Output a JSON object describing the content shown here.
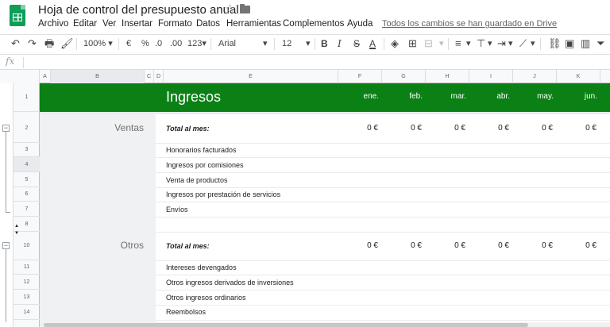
{
  "doc": {
    "title": "Hoja de control del presupuesto anual"
  },
  "menu": [
    "Archivo",
    "Editar",
    "Ver",
    "Insertar",
    "Formato",
    "Datos",
    "Herramientas",
    "Complementos",
    "Ayuda"
  ],
  "saved_status": "Todos los cambios se han guardado en Drive",
  "toolbar": {
    "zoom": "100%",
    "currency": "€",
    "percent": "%",
    "decrease_decimals": ".0",
    "increase_decimals": ".00",
    "format_more": "123",
    "font": "Arial",
    "font_size": "12",
    "bold": "B",
    "italic": "I",
    "strike": "S",
    "text_color": "A"
  },
  "formula_bar": {
    "fx": "fx"
  },
  "columns": [
    "A",
    "B",
    "C",
    "D",
    "E",
    "F",
    "G",
    "H",
    "I",
    "J",
    "K"
  ],
  "rows": [
    "1",
    "2",
    "3",
    "4",
    "5",
    "6",
    "7",
    "8",
    "10",
    "11",
    "12",
    "13",
    "14"
  ],
  "sheet": {
    "header_title": "Ingresos",
    "months": [
      "ene.",
      "feb.",
      "mar.",
      "abr.",
      "may.",
      "jun."
    ],
    "sections": [
      {
        "category": "Ventas",
        "total_label": "Total al mes:",
        "totals": [
          "0 €",
          "0 €",
          "0 €",
          "0 €",
          "0 €",
          "0 €"
        ],
        "items": [
          "Honorarios facturados",
          "Ingresos por comisiones",
          "Venta de productos",
          "Ingresos por prestación de servicios",
          "Envíos"
        ]
      },
      {
        "category": "Otros",
        "total_label": "Total al mes:",
        "totals": [
          "0 €",
          "0 €",
          "0 €",
          "0 €",
          "0 €",
          "0 €"
        ],
        "items": [
          "Intereses devengados",
          "Otros ingresos derivados de inversiones",
          "Otros ingresos ordinarios",
          "Reembolsos"
        ]
      }
    ]
  },
  "colors": {
    "header_green": "#0b8015",
    "sheets_green": "#0f9d58"
  }
}
